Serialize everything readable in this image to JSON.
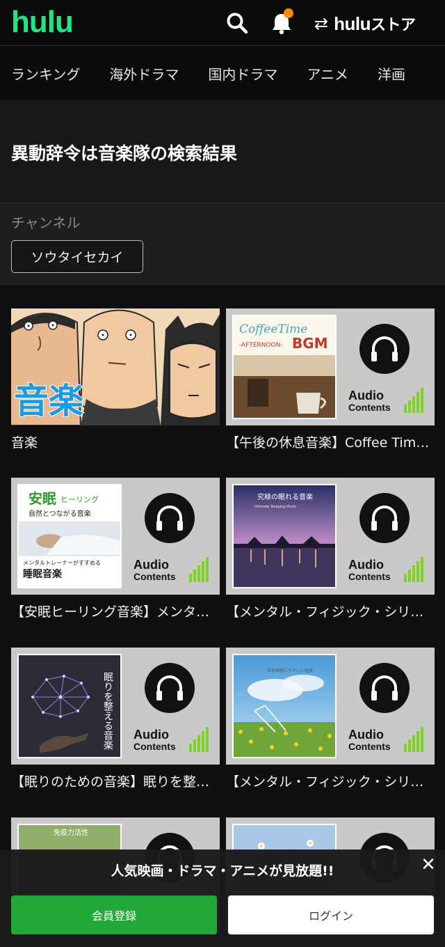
{
  "header": {
    "logo": "hulu",
    "store_prefix": "hulu",
    "store_suffix": "ストア",
    "notification_dot_color": "#ff8a00"
  },
  "nav": {
    "items": [
      "ランキング",
      "海外ドラマ",
      "国内ドラマ",
      "アニメ",
      "洋画"
    ]
  },
  "search": {
    "title": "異動辞令は音楽隊の検索結果"
  },
  "channel": {
    "label": "チャンネル",
    "chip": "ソウタイセカイ"
  },
  "audio_badge": {
    "audio": "Audio",
    "contents": "Contents"
  },
  "results": [
    {
      "title": "音楽",
      "thumb_text": "音楽"
    },
    {
      "title": "【午後の休息音楽】Coffee Time -AFTERNOON- BGM",
      "cover_title": "CoffeeTime",
      "cover_sub": "-AFTERNOON-",
      "cover_bgm": "BGM"
    },
    {
      "title": "【安眠ヒーリング音楽】メンタルトレーナーがすすめる睡眠音楽",
      "cover_title": "安眠",
      "cover_title2": "ヒーリング",
      "cover_sub": "自然とつながる音楽",
      "cover_note": "メンタルトレーナーがすすめる",
      "cover_main": "睡眠音楽"
    },
    {
      "title": "【メンタル・フィジック・シリーズ】究極の眠れる音楽",
      "cover_title": "究極の眠れる音楽",
      "cover_sub": "Ultimate Sleeping Music"
    },
    {
      "title": "【眠りのための音楽】眠りを整える音楽",
      "cover_title": "眠りを整える音楽"
    },
    {
      "title": "【メンタル・フィジック・シリーズ】",
      "cover_title": "自律神経にやさしい音楽"
    },
    {
      "title": "",
      "cover_title": "免疫力活性"
    },
    {
      "title": ""
    }
  ],
  "banner": {
    "text": "人気映画・ドラマ・アニメが見放題!!",
    "close": "✕",
    "join": "会員登録",
    "login": "ログイン"
  },
  "colors": {
    "brand": "#1ce783",
    "join_button": "#22a838",
    "audio_bars": "#7dd321"
  }
}
